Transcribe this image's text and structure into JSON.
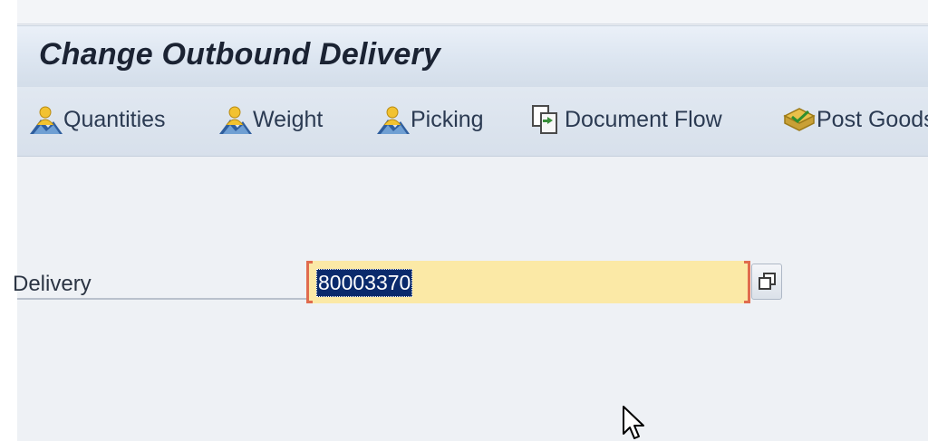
{
  "title": "Change Outbound Delivery",
  "toolbar": {
    "quantities": "Quantities",
    "weight": "Weight",
    "picking": "Picking",
    "document_flow": "Document Flow",
    "post_goods": "Post Goods Issue"
  },
  "form": {
    "delivery_label": "Delivery",
    "delivery_value": "80003370"
  },
  "icons": {
    "quantities": "person-mountain-icon",
    "weight": "person-mountain-icon",
    "picking": "person-mountain-icon",
    "document_flow": "document-flow-icon",
    "post_goods": "post-goods-issue-icon",
    "value_help": "value-help-icon",
    "cursor": "mouse-pointer-icon"
  },
  "colors": {
    "title_text": "#1b2333",
    "field_highlight": "#fbe9a6",
    "selection": "#0a2a6c",
    "required_bracket": "#e06c4e"
  }
}
